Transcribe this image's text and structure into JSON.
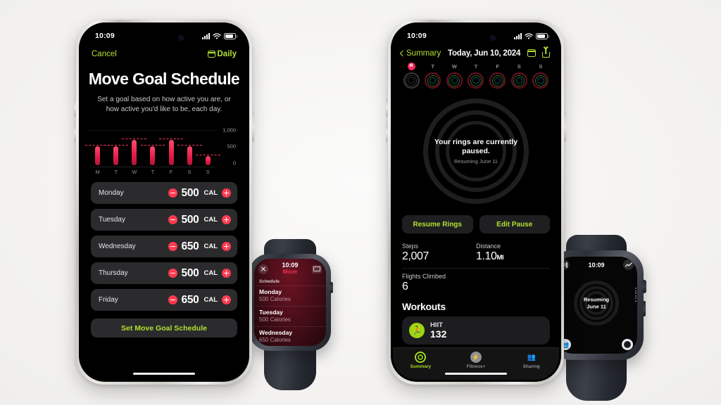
{
  "background_color": "#f6f5f3",
  "accent_green": "#b4e032",
  "accent_red": "#ff3b50",
  "phone_left": {
    "status_bar": {
      "time": "10:09",
      "signal": "signal-bars",
      "wifi": "wifi-icon",
      "battery": "battery-icon"
    },
    "nav": {
      "cancel": "Cancel",
      "daily": "Daily",
      "daily_icon": "calendar-icon"
    },
    "title": "Move Goal Schedule",
    "subtitle": "Set a goal based on how active you are, or how active you'd like to be, each day.",
    "chart_data": {
      "type": "bar",
      "title": "Move Goal Schedule",
      "categories": [
        "M",
        "T",
        "W",
        "T",
        "F",
        "S",
        "S"
      ],
      "values": [
        500,
        500,
        650,
        500,
        650,
        500,
        250
      ],
      "series": [
        {
          "name": "Move Goal (calories)",
          "values": [
            500,
            500,
            650,
            500,
            650,
            500,
            250
          ]
        }
      ],
      "goal_lines": [
        500,
        500,
        650,
        500,
        650,
        500,
        250
      ],
      "ylim": [
        0,
        1000
      ],
      "yticks": [
        "1,000",
        "500",
        "0"
      ],
      "ylabel": "",
      "xlabel": "",
      "grid": false,
      "legend": "none",
      "bar_color": "#e81d4a",
      "goal_line_color": "#ff3b5c"
    },
    "rows": [
      {
        "day": "Monday",
        "value": "500",
        "unit": "CAL"
      },
      {
        "day": "Tuesday",
        "value": "500",
        "unit": "CAL"
      },
      {
        "day": "Wednesday",
        "value": "650",
        "unit": "CAL"
      },
      {
        "day": "Thursday",
        "value": "500",
        "unit": "CAL"
      },
      {
        "day": "Friday",
        "value": "650",
        "unit": "CAL"
      }
    ],
    "cta": "Set Move Goal Schedule"
  },
  "phone_right": {
    "status_bar": {
      "time": "10:09"
    },
    "nav": {
      "back": "Summary",
      "date": "Today, Jun 10, 2024",
      "calendar_icon": "calendar-icon",
      "share_icon": "share-icon"
    },
    "week_strip": {
      "days": [
        "M",
        "T",
        "W",
        "T",
        "F",
        "S",
        "S"
      ],
      "today_index": 0
    },
    "rings": {
      "headline": "Your rings are currently paused.",
      "sub": "Resuming June 11"
    },
    "buttons": {
      "resume": "Resume Rings",
      "edit": "Edit Pause"
    },
    "metrics": [
      {
        "label": "Steps",
        "value": "2,007",
        "unit": ""
      },
      {
        "label": "Distance",
        "value": "1.10",
        "unit": "MI"
      },
      {
        "label": "Flights Climbed",
        "value": "6",
        "unit": ""
      }
    ],
    "workouts": {
      "title": "Workouts",
      "items": [
        {
          "name": "HIIT",
          "value": "132",
          "icon": "hiit-icon"
        }
      ]
    },
    "tabs": [
      {
        "label": "Summary",
        "icon": "rings-icon",
        "active": true
      },
      {
        "label": "Fitness+",
        "icon": "bolt-icon",
        "active": false
      },
      {
        "label": "Sharing",
        "icon": "people-icon",
        "active": false
      }
    ]
  },
  "watch_left": {
    "close_icon": "close-icon",
    "time": "10:09",
    "app": "Move",
    "calendar_icon": "calendar-icon",
    "section": "Schedule",
    "items": [
      {
        "day": "Monday",
        "calories": "500 Calories"
      },
      {
        "day": "Tuesday",
        "calories": "500 Calories"
      },
      {
        "day": "Wednesday",
        "calories": "650 Calories"
      }
    ]
  },
  "watch_right": {
    "time": "10:09",
    "top_left_icon": "activity-bars-icon",
    "top_right_icon": "trend-line-icon",
    "center_line1": "Resuming",
    "center_line2": "June 11",
    "bottom_left_icon": "people-icon",
    "bottom_right_icon": "pills-icon"
  }
}
